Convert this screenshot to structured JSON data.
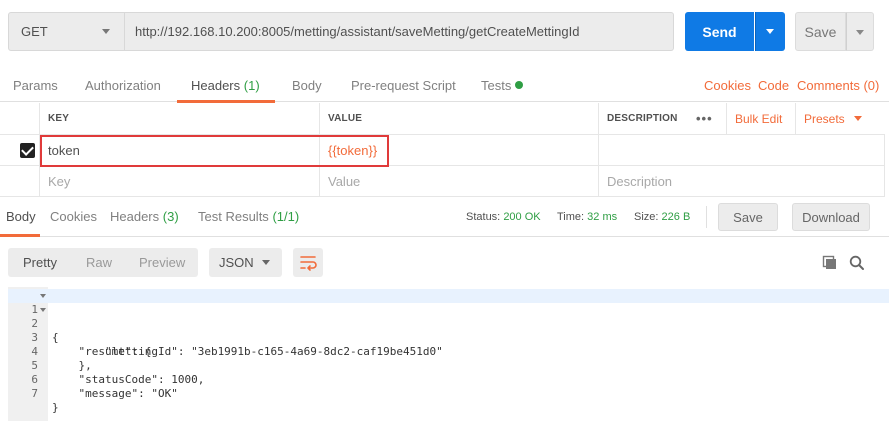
{
  "request": {
    "method": "GET",
    "url": "http://192.168.10.200:8005/metting/assistant/saveMetting/getCreateMettingId",
    "send_label": "Send",
    "save_label": "Save"
  },
  "request_tabs": {
    "params": "Params",
    "authorization": "Authorization",
    "headers": "Headers",
    "headers_count": "(1)",
    "body": "Body",
    "prerequest": "Pre-request Script",
    "tests": "Tests",
    "cookies": "Cookies",
    "code": "Code",
    "comments": "Comments (0)"
  },
  "headers_table": {
    "col_key": "KEY",
    "col_value": "VALUE",
    "col_description": "DESCRIPTION",
    "more": "•••",
    "bulk_edit": "Bulk Edit",
    "presets": "Presets",
    "rows": [
      {
        "key": "token",
        "value": "{{token}}",
        "description": "",
        "checked": true
      }
    ],
    "placeholder": {
      "key": "Key",
      "value": "Value",
      "description": "Description"
    }
  },
  "response_tabs": {
    "body": "Body",
    "cookies": "Cookies",
    "headers": "Headers",
    "headers_count": "(3)",
    "test_results": "Test Results",
    "test_results_count": "(1/1)"
  },
  "response_meta": {
    "status_label": "Status:",
    "status_value": "200 OK",
    "time_label": "Time:",
    "time_value": "32 ms",
    "size_label": "Size:",
    "size_value": "226 B",
    "save_label": "Save",
    "download_label": "Download"
  },
  "format_toolbar": {
    "pretty": "Pretty",
    "raw": "Raw",
    "preview": "Preview",
    "format": "JSON"
  },
  "code_lines": [
    {
      "n": "1",
      "text": "{"
    },
    {
      "n": "2",
      "text": "    \"result\": {"
    },
    {
      "n": "3",
      "text": "        \"mettingId\": \"3eb1991b-c165-4a69-8dc2-caf19be451d0\""
    },
    {
      "n": "4",
      "text": "    },"
    },
    {
      "n": "5",
      "text": "    \"statusCode\": 1000,"
    },
    {
      "n": "6",
      "text": "    \"message\": \"OK\""
    },
    {
      "n": "7",
      "text": "}"
    }
  ],
  "colors": {
    "accent": "#f26b3a",
    "send": "#0f7ae5",
    "success": "#2f9e44",
    "highlight": "#e03a3a"
  }
}
